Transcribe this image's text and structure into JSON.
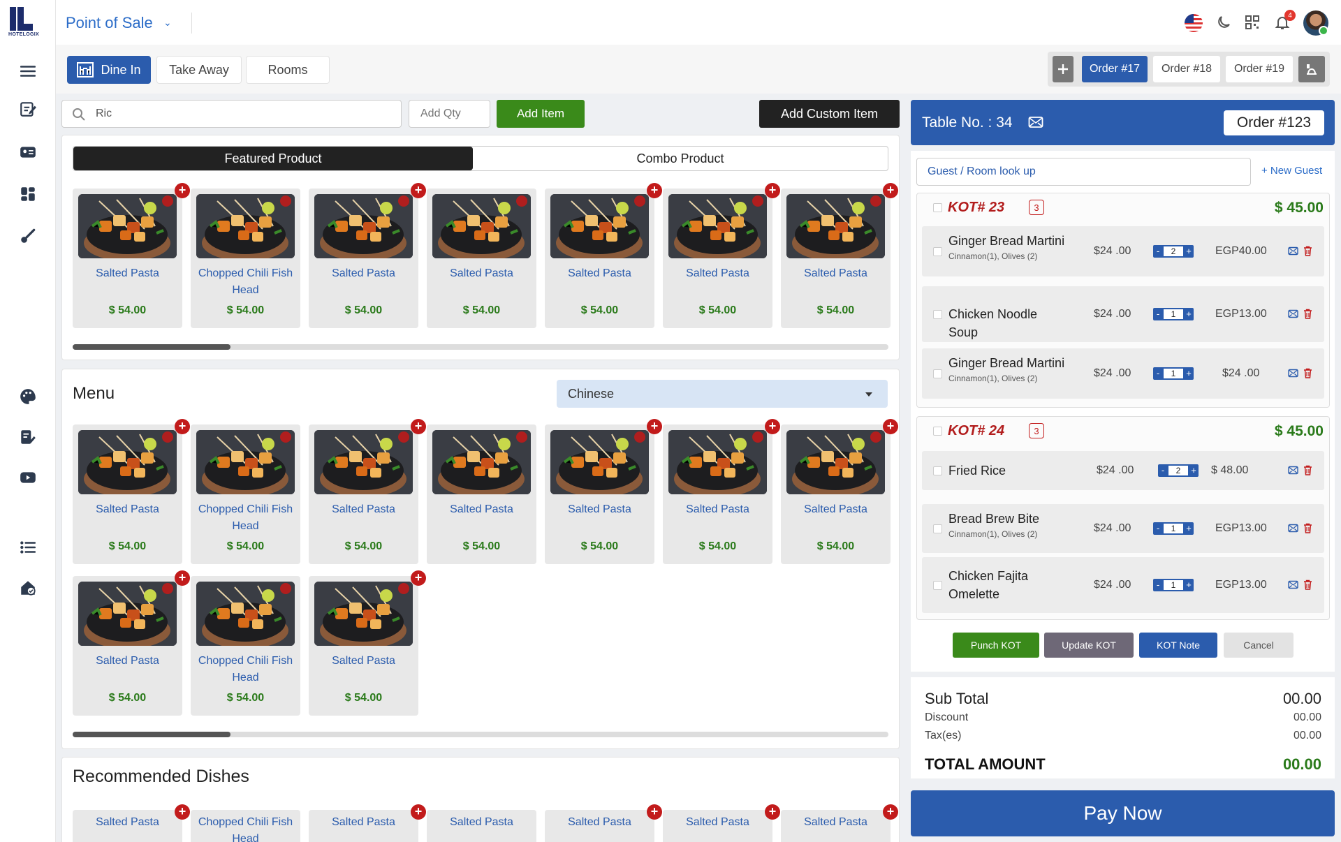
{
  "app": {
    "title": "Point of Sale",
    "logo_text": "HOTELOGIX",
    "notification_count": "4"
  },
  "service_tabs": [
    "Dine In",
    "Take Away",
    "Rooms"
  ],
  "orders": {
    "tabs": [
      "Order #17",
      "Order #18",
      "Order #19"
    ],
    "active": "Order #17"
  },
  "search": {
    "value": "Ric",
    "qty_placeholder": "Add Qty",
    "add_item": "Add Item",
    "add_custom": "Add Custom Item"
  },
  "featured": {
    "toggle": [
      "Featured Product",
      "Combo Product"
    ],
    "items": [
      {
        "name": "Salted Pasta",
        "price": "$ 54.00"
      },
      {
        "name": "Chopped Chili Fish Head",
        "price": "$ 54.00"
      },
      {
        "name": "Salted Pasta",
        "price": "$ 54.00"
      },
      {
        "name": "Salted Pasta",
        "price": "$ 54.00"
      },
      {
        "name": "Salted Pasta",
        "price": "$ 54.00"
      },
      {
        "name": "Salted Pasta",
        "price": "$ 54.00"
      },
      {
        "name": "Salted Pasta",
        "price": "$ 54.00"
      }
    ]
  },
  "menu": {
    "title": "Menu",
    "category": "Chinese",
    "items": [
      {
        "name": "Salted Pasta",
        "price": "$ 54.00"
      },
      {
        "name": "Chopped Chili Fish Head",
        "price": "$ 54.00"
      },
      {
        "name": "Salted Pasta",
        "price": "$ 54.00"
      },
      {
        "name": "Salted Pasta",
        "price": "$ 54.00"
      },
      {
        "name": "Salted Pasta",
        "price": "$ 54.00"
      },
      {
        "name": "Salted Pasta",
        "price": "$ 54.00"
      },
      {
        "name": "Salted Pasta",
        "price": "$ 54.00"
      },
      {
        "name": "Salted Pasta",
        "price": "$ 54.00"
      },
      {
        "name": "Chopped Chili Fish Head",
        "price": "$ 54.00"
      },
      {
        "name": "Salted Pasta",
        "price": "$ 54.00"
      }
    ]
  },
  "recommended": {
    "title": "Recommended Dishes",
    "items": [
      "Salted Pasta",
      "Chopped Chili Fish Head",
      "Salted Pasta",
      "Salted Pasta",
      "Salted Pasta",
      "Salted Pasta",
      "Salted Pasta"
    ]
  },
  "order_panel": {
    "table_label": "Table No. : 34",
    "order_label": "Order #123",
    "guest_placeholder": "Guest / Room  look up",
    "new_guest": "+ New Guest",
    "kots": [
      {
        "title": "KOT# 23",
        "count": "3",
        "total": "$ 45.00",
        "items": [
          {
            "name": "Ginger Bread Martini",
            "mods": "Cinnamon(1), Olives (2)",
            "price": "$24 .00",
            "qty": "2",
            "amount": "EGP40.00"
          },
          {
            "name": "Chicken Noodle Soup",
            "mods": "",
            "price": "$24 .00",
            "qty": "1",
            "amount": "EGP13.00"
          },
          {
            "name": "Ginger Bread Martini",
            "mods": "Cinnamon(1), Olives (2)",
            "price": "$24 .00",
            "qty": "1",
            "amount": "$24 .00"
          }
        ]
      },
      {
        "title": "KOT# 24",
        "count": "3",
        "total": "$ 45.00",
        "items": [
          {
            "name": "Fried Rice",
            "mods": "",
            "price": "$24 .00",
            "qty": "2",
            "amount": "$ 48.00"
          },
          {
            "name": "Bread Brew Bite",
            "mods": "Cinnamon(1), Olives (2)",
            "price": "$24 .00",
            "qty": "1",
            "amount": "EGP13.00"
          },
          {
            "name": "Chicken Fajita Omelette",
            "mods": "",
            "price": "$24 .00",
            "qty": "1",
            "amount": "EGP13.00"
          }
        ]
      }
    ],
    "actions": [
      "Punch KOT",
      "Update KOT",
      "KOT Note",
      "Cancel"
    ],
    "summary": {
      "subtotal_label": "Sub Total",
      "subtotal": "00.00",
      "discount_label": "Discount",
      "discount": "00.00",
      "tax_label": "Tax(es)",
      "tax": "00.00",
      "total_label": "TOTAL AMOUNT",
      "total": "00.00"
    },
    "pay_now": "Pay Now"
  },
  "colors": {
    "primary": "#2b5cad",
    "success": "#3a8a1a",
    "danger": "#c21b1b"
  }
}
